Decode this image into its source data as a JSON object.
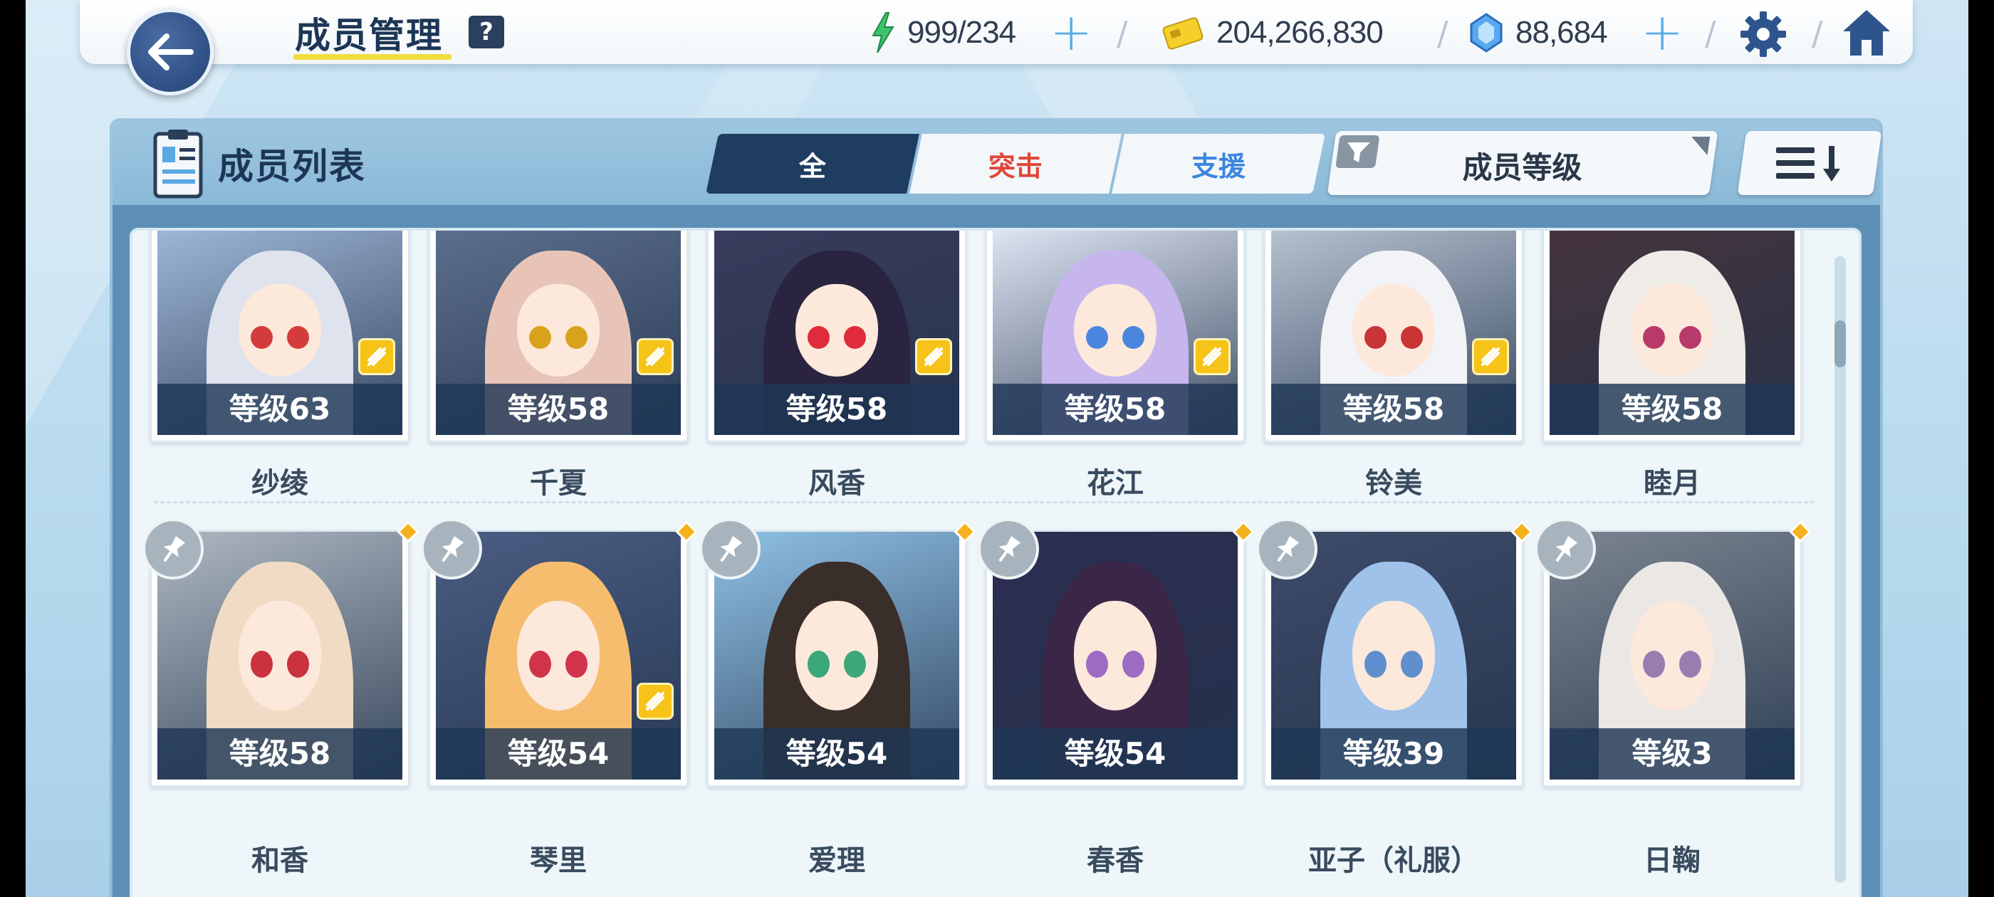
{
  "header": {
    "title": "成员管理",
    "help_label": "?",
    "energy": "999/234",
    "credits": "204,266,830",
    "gems": "88,684"
  },
  "panel": {
    "title": "成员列表",
    "tabs": [
      {
        "label": "全",
        "color": "#ffffff"
      },
      {
        "label": "突击",
        "color": "#e0453a"
      },
      {
        "label": "支援",
        "color": "#3b86de"
      }
    ],
    "sort_label": "成员等级"
  },
  "colors": {
    "accent": "#1f3d60",
    "underline": "#f2dd3f",
    "badge": "#f6c318",
    "level_band": "#1e3755"
  },
  "members": [
    {
      "name": "纱绫",
      "level": "等级63",
      "class_badge": true,
      "pinned": false,
      "hair": "#dfe3ee",
      "bg": "#9fb8d8",
      "eye": "#d43b3b"
    },
    {
      "name": "千夏",
      "level": "等级58",
      "class_badge": true,
      "pinned": false,
      "hair": "#e8c4b8",
      "bg": "#5c6f8e",
      "eye": "#d8a21b"
    },
    {
      "name": "风香",
      "level": "等级58",
      "class_badge": true,
      "pinned": false,
      "hair": "#2b2440",
      "bg": "#3a3c5c",
      "eye": "#e02c3a"
    },
    {
      "name": "花江",
      "level": "等级58",
      "class_badge": true,
      "pinned": false,
      "hair": "#c7b6ee",
      "bg": "#dfe6f4",
      "eye": "#4a86dd"
    },
    {
      "name": "铃美",
      "level": "等级58",
      "class_badge": true,
      "pinned": false,
      "hair": "#f1f3f7",
      "bg": "#b7c3d3",
      "eye": "#c93434"
    },
    {
      "name": "睦月",
      "level": "等级58",
      "class_badge": false,
      "pinned": false,
      "hair": "#efece8",
      "bg": "#46343c",
      "eye": "#b73a6a"
    },
    {
      "name": "和香",
      "level": "等级58",
      "class_badge": false,
      "pinned": true,
      "hair": "#f0dcc4",
      "bg": "#aeb8c2",
      "eye": "#c9323e"
    },
    {
      "name": "琴里",
      "level": "等级54",
      "class_badge": true,
      "pinned": true,
      "hair": "#f7bd6e",
      "bg": "#4a5d83",
      "eye": "#d0344a"
    },
    {
      "name": "爱理",
      "level": "等级54",
      "class_badge": false,
      "pinned": true,
      "hair": "#3a2e2a",
      "bg": "#8fc1e6",
      "eye": "#3aa878"
    },
    {
      "name": "春香",
      "level": "等级54",
      "class_badge": false,
      "pinned": true,
      "hair": "#3a2748",
      "bg": "#2d2e52",
      "eye": "#9c6bc3"
    },
    {
      "name": "亚子（礼服）",
      "level": "等级39",
      "class_badge": false,
      "pinned": true,
      "hair": "#9ec2ea",
      "bg": "#3e4b6a",
      "eye": "#5f8fcc"
    },
    {
      "name": "日鞠",
      "level": "等级3",
      "class_badge": false,
      "pinned": true,
      "hair": "#ebe7e4",
      "bg": "#7b8590",
      "eye": "#9a7db0"
    }
  ]
}
